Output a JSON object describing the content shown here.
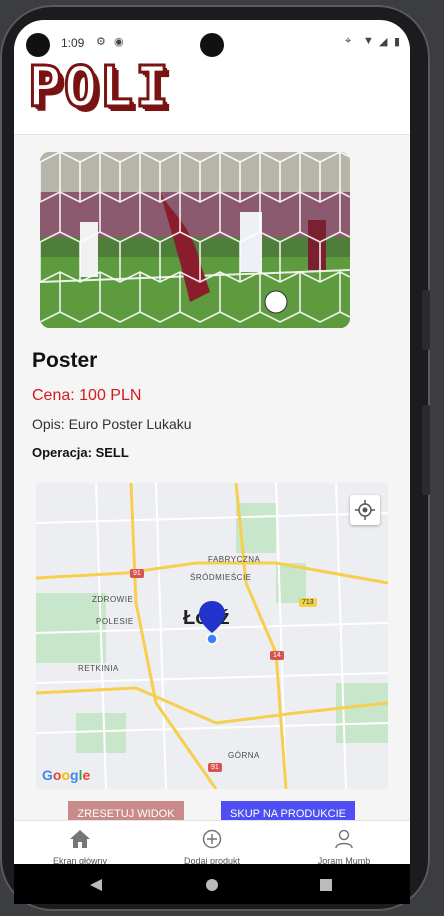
{
  "status_bar": {
    "time": "1:09"
  },
  "header": {
    "logo_text": "POLI"
  },
  "product": {
    "title": "Poster",
    "price": "Cena: 100 PLN",
    "description": "Opis: Euro Poster Lukaku",
    "operation": "Operacja: SELL"
  },
  "map": {
    "city": "Łódź",
    "districts": [
      "FABRYCZNA",
      "ŚRÓDMIEŚCIE",
      "ZDROWIE",
      "POLESIE",
      "RETKINIA",
      "GÓRNA"
    ],
    "road_numbers": [
      "91",
      "713",
      "14",
      "91"
    ],
    "attribution": "Google"
  },
  "actions": {
    "reset_label": "ZRESETUJ WIDOK",
    "buy_label": "SKUP NA PRODUKCIE"
  },
  "nav": {
    "home_label": "Ekran główny",
    "add_label": "Dodaj produkt",
    "profile_label": "Joram Mumb"
  },
  "colors": {
    "price": "#d11b1b",
    "logo": "#7a1212",
    "reset_button": "#c98a8a",
    "buy_button": "#4e4ef2",
    "map_pin": "#2233cc"
  }
}
